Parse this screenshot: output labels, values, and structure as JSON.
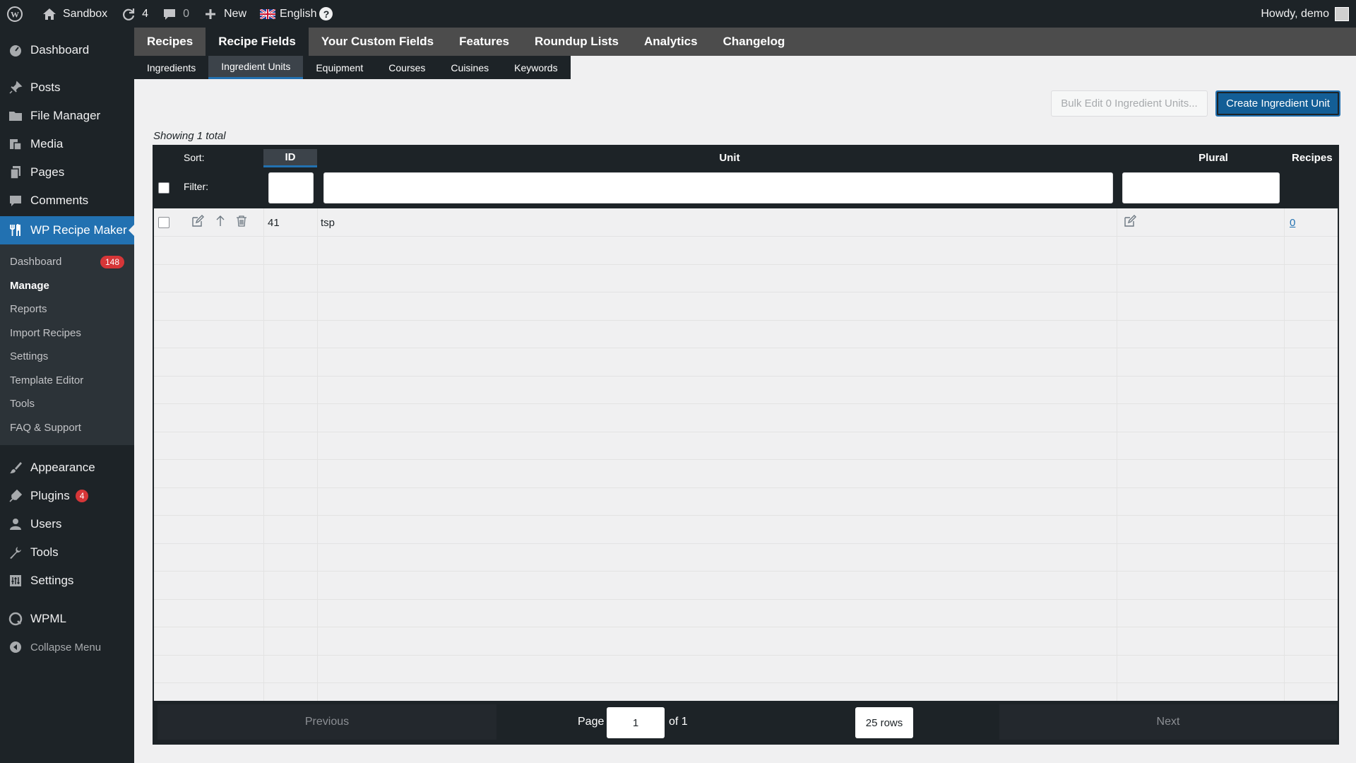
{
  "admin_bar": {
    "site_name": "Sandbox",
    "updates_count": "4",
    "comments_count": "0",
    "new_label": "New",
    "language": "English",
    "greeting": "Howdy, demo"
  },
  "sidebar": {
    "items_top": [
      {
        "label": "Dashboard",
        "icon": "dashboard-icon"
      }
    ],
    "items_mid": [
      {
        "label": "Posts",
        "icon": "pin-icon"
      },
      {
        "label": "File Manager",
        "icon": "folder-icon"
      },
      {
        "label": "Media",
        "icon": "media-icon"
      },
      {
        "label": "Pages",
        "icon": "pages-icon"
      },
      {
        "label": "Comments",
        "icon": "comment-icon"
      }
    ],
    "current": {
      "label": "WP Recipe Maker",
      "icon": "utensils-icon"
    },
    "submenu": [
      {
        "label": "Dashboard",
        "badge": "148"
      },
      {
        "label": "Manage"
      },
      {
        "label": "Reports"
      },
      {
        "label": "Import Recipes"
      },
      {
        "label": "Settings"
      },
      {
        "label": "Template Editor"
      },
      {
        "label": "Tools"
      },
      {
        "label": "FAQ & Support"
      }
    ],
    "items_bottom": [
      {
        "label": "Appearance",
        "icon": "brush-icon"
      },
      {
        "label": "Plugins",
        "icon": "plugin-icon",
        "badge": "4"
      },
      {
        "label": "Users",
        "icon": "user-icon"
      },
      {
        "label": "Tools",
        "icon": "wrench-icon"
      },
      {
        "label": "Settings",
        "icon": "settings-icon"
      }
    ],
    "wpml": "WPML",
    "collapse": "Collapse Menu"
  },
  "main_tabs": [
    "Recipes",
    "Recipe Fields",
    "Your Custom Fields",
    "Features",
    "Roundup Lists",
    "Analytics",
    "Changelog"
  ],
  "sub_tabs": [
    "Ingredients",
    "Ingredient Units",
    "Equipment",
    "Courses",
    "Cuisines",
    "Keywords"
  ],
  "buttons": {
    "bulk_edit": "Bulk Edit 0 Ingredient Units...",
    "create": "Create Ingredient Unit"
  },
  "showing": "Showing 1 total",
  "table": {
    "sort_label": "Sort:",
    "filter_label": "Filter:",
    "columns": {
      "id": "ID",
      "unit": "Unit",
      "plural": "Plural",
      "recipes": "Recipes"
    },
    "rows": [
      {
        "id": "41",
        "unit": "tsp",
        "plural": "",
        "recipes": "0"
      }
    ]
  },
  "pagination": {
    "previous": "Previous",
    "page_label": "Page",
    "page_value": "1",
    "of_label": "of 1",
    "rows_select": "25 rows",
    "next": "Next"
  },
  "colors": {
    "accent": "#2271b1",
    "admin_dark": "#1d2327",
    "badge_red": "#d63638"
  }
}
